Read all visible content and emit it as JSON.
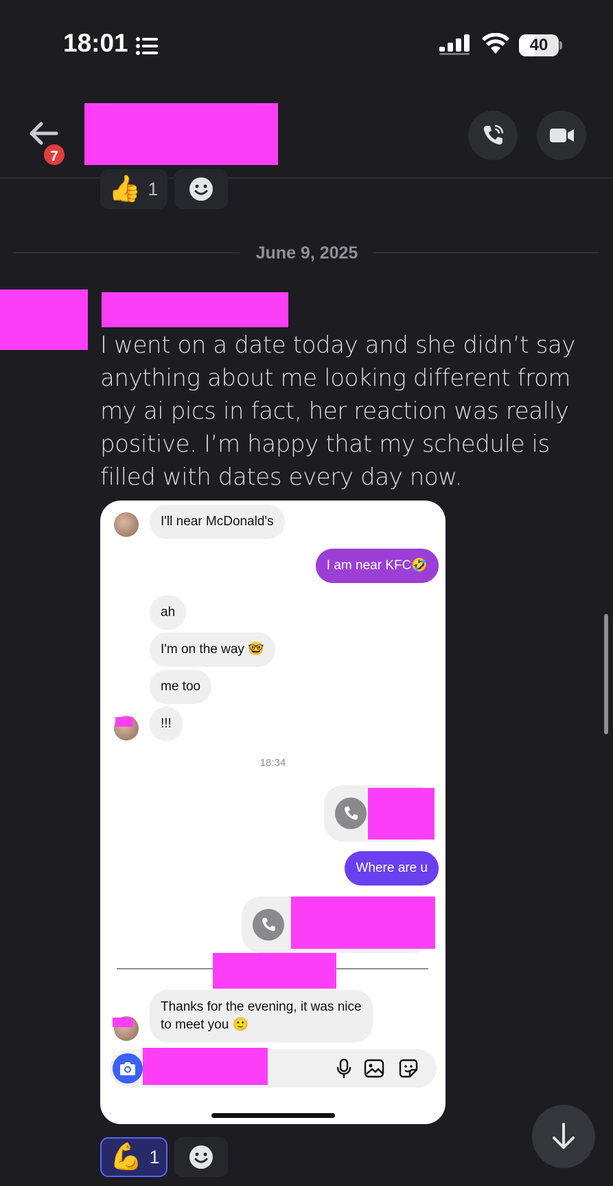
{
  "status_bar": {
    "time": "18:01",
    "battery": "40",
    "battery_level": 0.4
  },
  "header": {
    "unread_count": "7"
  },
  "reactions_top": [
    {
      "emoji": "👍",
      "count": "1"
    }
  ],
  "date_divider": "June 9, 2025",
  "message": {
    "text": "I went on a date today and she didn’t say anything about me looking different from my ai pics in fact, her reaction was really positive. I’m happy that my schedule is filled with dates every day now."
  },
  "screenshot": {
    "messages": [
      {
        "side": "in",
        "text": "I'll near McDonald's"
      },
      {
        "side": "out",
        "text": "I am near KFC🤣",
        "color": "#9b3fd6"
      },
      {
        "side": "in",
        "text": "ah"
      },
      {
        "side": "in",
        "text": "I'm on the way 🤓"
      },
      {
        "side": "in",
        "text": "me too"
      },
      {
        "side": "in",
        "text": "!!!"
      },
      {
        "side": "out",
        "text": "Where are u",
        "color": "#6a3ff0"
      },
      {
        "side": "in",
        "text": "Thanks for the evening, it was nice\nto meet you 🙂"
      }
    ],
    "timestamp": "18:34"
  },
  "reactions_bottom": [
    {
      "emoji": "💪",
      "count": "1",
      "selected": true
    }
  ],
  "colors": {
    "background": "#1c1c21",
    "redaction": "#fd3ef9",
    "accent": "#5865f2"
  },
  "icons": [
    "list-icon",
    "signal-icon",
    "wifi-icon",
    "back-arrow-icon",
    "phone-icon",
    "video-camera-icon",
    "add-reaction-icon",
    "camera-icon",
    "microphone-icon",
    "image-icon",
    "sticker-icon",
    "arrow-down-icon"
  ]
}
